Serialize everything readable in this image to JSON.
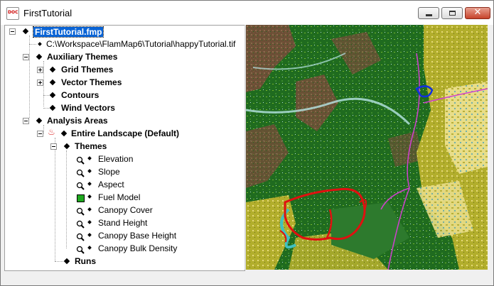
{
  "window": {
    "title": "FirstTutorial",
    "app_icon_text": "DOC"
  },
  "tree": {
    "root": "FirstTutorial.fmp",
    "file_path": "C:\\Workspace\\FlamMap6\\Tutorial\\happyTutorial.tif",
    "auxiliary_themes": "Auxiliary Themes",
    "grid_themes": "Grid Themes",
    "vector_themes": "Vector Themes",
    "contours": "Contours",
    "wind_vectors": "Wind Vectors",
    "analysis_areas": "Analysis Areas",
    "entire_landscape": "Entire Landscape (Default)",
    "themes": "Themes",
    "layers": [
      "Elevation",
      "Slope",
      "Aspect",
      "Fuel Model",
      "Canopy Cover",
      "Stand Height",
      "Canopy Base Height",
      "Canopy Bulk Density"
    ],
    "runs": "Runs"
  },
  "colors": {
    "selection": "#0a64d6",
    "fire_perimeter": "#e01010",
    "river": "#d040d0",
    "lake": "#1030e0"
  }
}
